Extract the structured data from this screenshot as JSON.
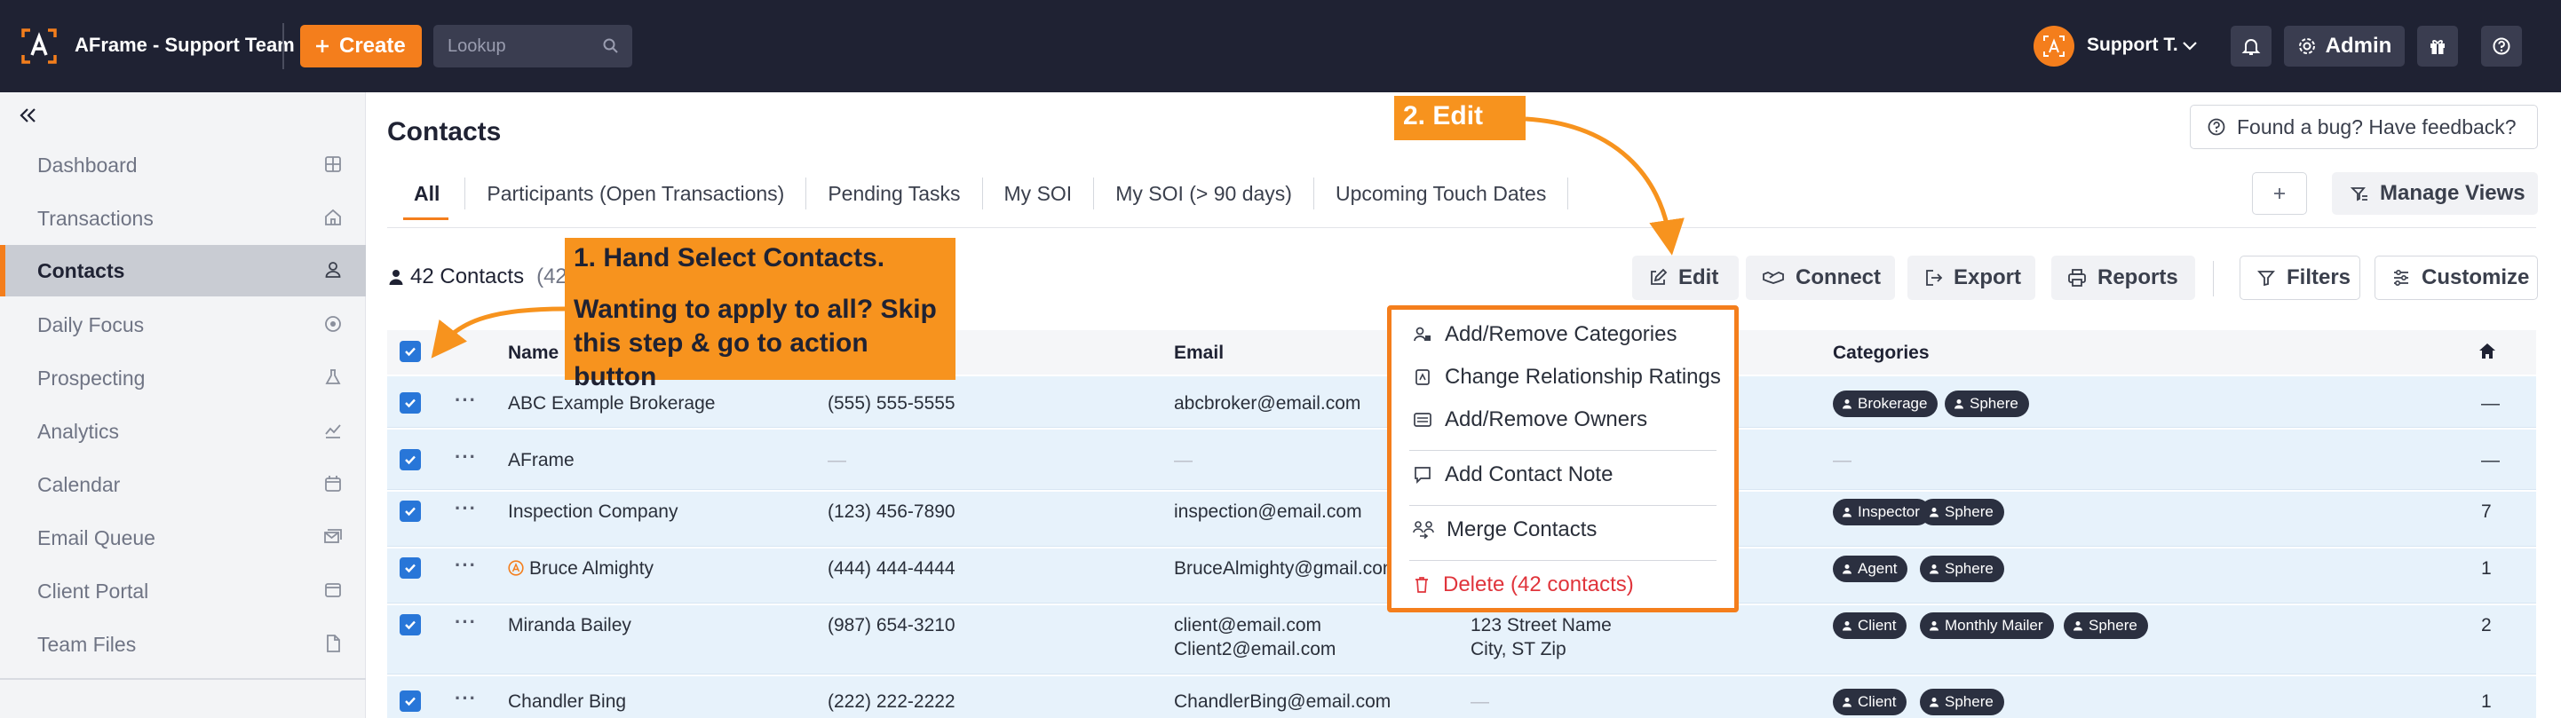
{
  "topbar": {
    "app_title": "AFrame - Support Team",
    "create_label": "Create",
    "lookup_placeholder": "Lookup",
    "user_name": "Support T.",
    "admin_label": "Admin"
  },
  "sidebar": {
    "items": [
      {
        "label": "Dashboard",
        "icon": "dashboard-icon"
      },
      {
        "label": "Transactions",
        "icon": "home-icon"
      },
      {
        "label": "Contacts",
        "icon": "person-icon",
        "active": true
      },
      {
        "label": "Daily Focus",
        "icon": "target-icon"
      },
      {
        "label": "Prospecting",
        "icon": "flask-icon"
      },
      {
        "label": "Analytics",
        "icon": "chart-icon"
      },
      {
        "label": "Calendar",
        "icon": "calendar-icon"
      },
      {
        "label": "Email Queue",
        "icon": "mail-queue-icon"
      },
      {
        "label": "Client Portal",
        "icon": "portal-icon"
      },
      {
        "label": "Team Files",
        "icon": "file-icon"
      }
    ]
  },
  "main": {
    "title": "Contacts",
    "feedback_label": "Found a bug? Have feedback?",
    "tabs": [
      "All",
      "Participants (Open Transactions)",
      "Pending Tasks",
      "My SOI",
      "My SOI (> 90 days)",
      "Upcoming Touch Dates"
    ],
    "manage_views_label": "Manage Views",
    "count_label": "42 Contacts",
    "count_suffix": "(42",
    "actions": {
      "edit": "Edit",
      "connect": "Connect",
      "export": "Export",
      "reports": "Reports",
      "filters": "Filters",
      "customize": "Customize"
    }
  },
  "table": {
    "headers": {
      "name": "Name",
      "email": "Email",
      "categories": "Categories"
    },
    "rows": [
      {
        "name": "ABC Example Brokerage",
        "phone": "(555) 555-5555",
        "email": "abcbroker@email.com",
        "email2": "",
        "address": "",
        "address2": "",
        "categories": [
          "Brokerage",
          "Sphere"
        ],
        "count": "—"
      },
      {
        "name": "AFrame",
        "phone": "—",
        "email": "—",
        "email2": "",
        "address": "",
        "address2": "",
        "categories": [],
        "cat_dash": "—",
        "count": "—"
      },
      {
        "name": "Inspection Company",
        "phone": "(123) 456-7890",
        "email": "inspection@email.com",
        "email2": "",
        "address": "",
        "address2": "",
        "categories": [
          "Inspector",
          "Sphere"
        ],
        "count": "7"
      },
      {
        "name": "Bruce Almighty",
        "phone": "(444) 444-4444",
        "email": "BruceAlmighty@gmail.com",
        "email2": "",
        "address": "",
        "address2": "",
        "categories": [
          "Agent",
          "Sphere"
        ],
        "count": "1"
      },
      {
        "name": "Miranda Bailey",
        "phone": "(987) 654-3210",
        "email": "client@email.com",
        "email2": "Client2@email.com",
        "address": "123 Street Name",
        "address2": "City, ST Zip",
        "categories": [
          "Client",
          "Monthly Mailer",
          "Sphere"
        ],
        "count": "2"
      },
      {
        "name": "Chandler Bing",
        "phone": "(222) 222-2222",
        "email": "ChandlerBing@email.com",
        "email2": "",
        "address": "—",
        "address2": "",
        "categories": [
          "Client",
          "Sphere"
        ],
        "count": "1"
      }
    ]
  },
  "edit_menu": {
    "items": [
      "Add/Remove Categories",
      "Change Relationship Ratings",
      "Add/Remove Owners",
      "Add Contact Note",
      "Merge Contacts",
      "Delete (42 contacts)"
    ]
  },
  "annotations": {
    "step1_title": "1. Hand Select Contacts.",
    "step1_body": "Wanting to apply to all? Skip this step & go to action button",
    "step2": "2. Edit"
  },
  "colors": {
    "accent": "#f47e1c",
    "topbar": "#1f2233",
    "row_selected": "#e7f2fb",
    "checkbox": "#2876d8",
    "tag": "#2b3040",
    "danger": "#e0343b"
  }
}
